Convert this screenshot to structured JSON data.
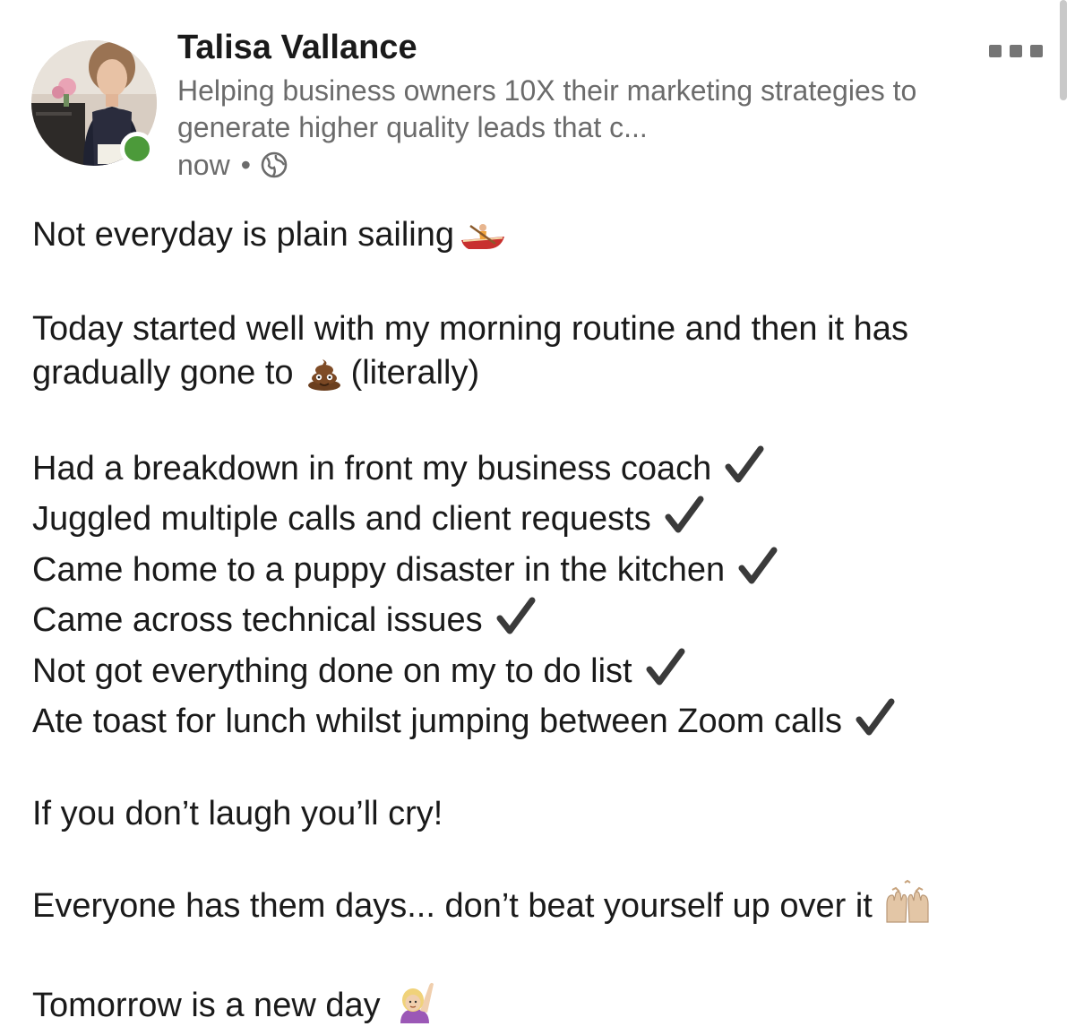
{
  "author": {
    "name": "Talisa Vallance",
    "headline": "Helping business owners 10X their marketing strategies to generate higher quality leads that c...",
    "timestamp": "now",
    "separator": "•",
    "visibility_icon": "globe-icon",
    "presence": "online",
    "presence_color": "#4c9a3a"
  },
  "menu": {
    "icon": "more-options-icon"
  },
  "post": {
    "line1": "Not everyday is plain sailing",
    "line1_emoji": "rowboat-emoji",
    "line2a": "Today started well with my morning routine and then it has",
    "line2b_start": "gradually gone to",
    "line2b_emoji": "poop-emoji",
    "line2b_end": "(literally)",
    "checklist": [
      "Had a breakdown in front my business coach",
      "Juggled multiple calls and client requests",
      "Came home to a puppy disaster in the kitchen",
      "Came across technical issues",
      "Not got everything done on my to do list",
      "Ate toast for lunch whilst jumping between Zoom calls"
    ],
    "check_icon": "checkmark-icon",
    "line3": "If you don’t laugh you’ll cry!",
    "line4": "Everyone has them days... don’t beat yourself up over it",
    "line4_emoji": "raising-hands-emoji",
    "line5": "Tomorrow is a new day",
    "line5_emoji": "person-raising-hand-emoji"
  }
}
